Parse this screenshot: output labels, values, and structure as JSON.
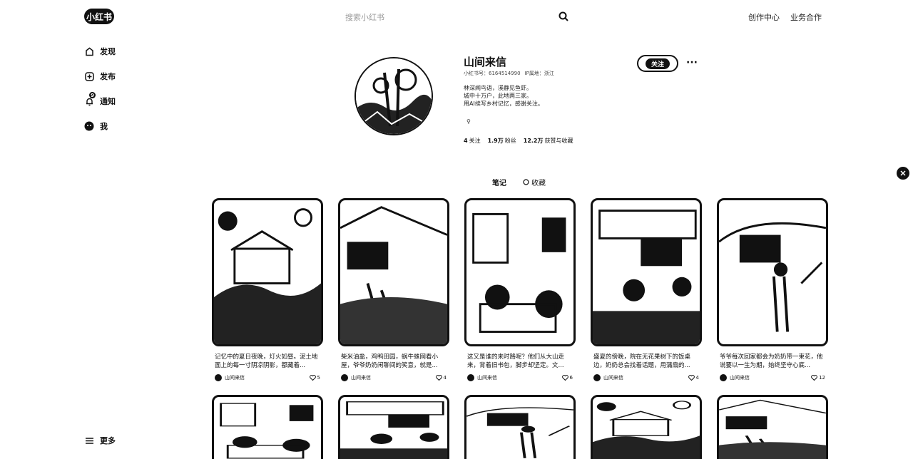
{
  "header": {
    "logo": "小红书",
    "search_placeholder": "搜索小红书",
    "nav": [
      "创作中心",
      "业务合作"
    ]
  },
  "sidebar": {
    "items": [
      {
        "label": "发现",
        "icon": "discover-icon"
      },
      {
        "label": "发布",
        "icon": "plus-icon"
      },
      {
        "label": "通知",
        "icon": "bell-icon",
        "badge": "9"
      },
      {
        "label": "我",
        "icon": "avatar-icon"
      }
    ],
    "more": "更多"
  },
  "profile": {
    "name": "山间来信",
    "id_text": "小红书号：6164514990",
    "ip_text": "IP属地：浙江",
    "bio": [
      "林深闻鸟语，溪静见鱼虾。",
      "城中十万户，此地两三家。",
      "用AI续写乡村记忆，感谢关注。"
    ],
    "gender": "♀",
    "stats": [
      {
        "num": "4",
        "label": "关注"
      },
      {
        "num": "1.9万",
        "label": "粉丝"
      },
      {
        "num": "12.2万",
        "label": "获赞与收藏"
      }
    ],
    "follow_label": "关注",
    "more_label": "···"
  },
  "tabs": {
    "notes": "笔记",
    "collect": "收藏"
  },
  "notes": [
    {
      "title": "记忆中的夏日夜晚，灯火如昼。泥土地面上的每一寸阴凉阴影，都藏着...",
      "author": "山间来信",
      "likes": "5"
    },
    {
      "title": "柴米油盐，鸡鸭田园，蜗牛蛛网看小屋，爷爷奶奶闲聊间的笑意，就是...",
      "author": "山间来信",
      "likes": "4"
    },
    {
      "title": "这又是谁的来时路呢？他们从大山走来，背着旧书包，脚步却坚定。文...",
      "author": "山间来信",
      "likes": "6"
    },
    {
      "title": "盛夏的傍晚，院在无花果树下的饭桌边，奶奶总会找着话题，用蒲扇的...",
      "author": "山间来信",
      "likes": "4"
    },
    {
      "title": "爷爷每次回家都会为奶奶带一束花，他说要以一生为期，始终坚守心底...",
      "author": "山间来信",
      "likes": "12"
    }
  ]
}
